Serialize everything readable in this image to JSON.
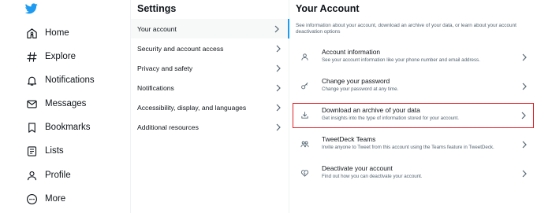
{
  "colors": {
    "accent": "#1d9bf0",
    "highlight_border": "#e0242b",
    "secondary_text": "#536471"
  },
  "nav": {
    "logo": "twitter-bird-icon",
    "items": [
      {
        "label": "Home",
        "icon": "home-icon"
      },
      {
        "label": "Explore",
        "icon": "hashtag-icon"
      },
      {
        "label": "Notifications",
        "icon": "bell-icon"
      },
      {
        "label": "Messages",
        "icon": "envelope-icon"
      },
      {
        "label": "Bookmarks",
        "icon": "bookmark-icon"
      },
      {
        "label": "Lists",
        "icon": "list-icon"
      },
      {
        "label": "Profile",
        "icon": "person-icon"
      },
      {
        "label": "More",
        "icon": "more-icon"
      }
    ]
  },
  "settings": {
    "title": "Settings",
    "items": [
      {
        "label": "Your account",
        "active": true
      },
      {
        "label": "Security and account access"
      },
      {
        "label": "Privacy and safety"
      },
      {
        "label": "Notifications"
      },
      {
        "label": "Accessibility, display, and languages"
      },
      {
        "label": "Additional resources"
      }
    ]
  },
  "account": {
    "title": "Your Account",
    "description": "See information about your account, download an archive of your data, or learn about your account deactivation options",
    "items": [
      {
        "title": "Account information",
        "subtitle": "See your account information like your phone number and email address.",
        "icon": "person-icon"
      },
      {
        "title": "Change your password",
        "subtitle": "Change your password at any time.",
        "icon": "key-icon"
      },
      {
        "title": "Download an archive of your data",
        "subtitle": "Get insights into the type of information stored for your account.",
        "icon": "download-icon",
        "highlighted": true
      },
      {
        "title": "TweetDeck Teams",
        "subtitle": "Invite anyone to Tweet from this account using the Teams feature in TweetDeck.",
        "icon": "people-icon"
      },
      {
        "title": "Deactivate your account",
        "subtitle": "Find out how you can deactivate your account.",
        "icon": "broken-heart-icon"
      }
    ]
  }
}
